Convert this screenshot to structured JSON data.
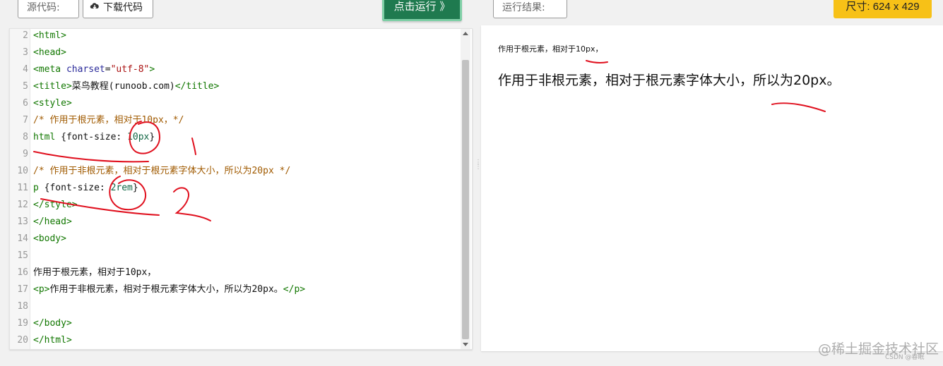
{
  "toolbar": {
    "source_label": "源代码:",
    "download_label": "下载代码",
    "run_label": "点击运行 》",
    "result_label": "运行结果:",
    "size_label": "尺寸: 624 x 429"
  },
  "editor": {
    "lines": [
      {
        "n": "2",
        "parts": [
          [
            "c-tag",
            "<html>"
          ]
        ]
      },
      {
        "n": "3",
        "parts": [
          [
            "c-tag",
            "<head>"
          ]
        ]
      },
      {
        "n": "4",
        "parts": [
          [
            "c-tag",
            "<meta "
          ],
          [
            "c-attr",
            "charset"
          ],
          [
            "c-text",
            "="
          ],
          [
            "c-str",
            "\"utf-8\""
          ],
          [
            "c-tag",
            ">"
          ]
        ]
      },
      {
        "n": "5",
        "parts": [
          [
            "c-tag",
            "<title>"
          ],
          [
            "c-text",
            "菜鸟教程(runoob.com)"
          ],
          [
            "c-tag",
            "</title>"
          ]
        ]
      },
      {
        "n": "6",
        "parts": [
          [
            "c-tag",
            "<style>"
          ]
        ]
      },
      {
        "n": "7",
        "parts": [
          [
            "c-comment",
            "/* 作用于根元素，相对于10px，*/"
          ]
        ]
      },
      {
        "n": "8",
        "parts": [
          [
            "c-sel",
            "html"
          ],
          [
            "c-text",
            " {font-size: "
          ],
          [
            "c-num",
            "10px"
          ],
          [
            "c-text",
            "}"
          ]
        ]
      },
      {
        "n": "9",
        "parts": []
      },
      {
        "n": "10",
        "parts": [
          [
            "c-comment",
            "/* 作用于非根元素，相对于根元素字体大小，所以为20px */"
          ]
        ]
      },
      {
        "n": "11",
        "parts": [
          [
            "c-sel",
            "p"
          ],
          [
            "c-text",
            " {font-size: "
          ],
          [
            "c-num",
            "2rem"
          ],
          [
            "c-text",
            "}"
          ]
        ]
      },
      {
        "n": "12",
        "parts": [
          [
            "c-tag",
            "</style>"
          ]
        ]
      },
      {
        "n": "13",
        "parts": [
          [
            "c-tag",
            "</head>"
          ]
        ]
      },
      {
        "n": "14",
        "parts": [
          [
            "c-tag",
            "<body>"
          ]
        ]
      },
      {
        "n": "15",
        "parts": []
      },
      {
        "n": "16",
        "parts": [
          [
            "c-text",
            "作用于根元素，相对于10px，"
          ]
        ]
      },
      {
        "n": "17",
        "parts": [
          [
            "c-tag",
            "<p>"
          ],
          [
            "c-text",
            "作用于非根元素，相对于根元素字体大小，所以为20px。"
          ],
          [
            "c-tag",
            "</p>"
          ]
        ]
      },
      {
        "n": "18",
        "parts": []
      },
      {
        "n": "19",
        "parts": [
          [
            "c-tag",
            "</body>"
          ]
        ]
      },
      {
        "n": "20",
        "parts": [
          [
            "c-tag",
            "</html>"
          ]
        ]
      }
    ]
  },
  "preview": {
    "small_text": "作用于根元素，相对于10px，",
    "large_text": "作用于非根元素，相对于根元素字体大小，所以为20px。"
  },
  "watermark": {
    "text": "@稀土掘金技术社区",
    "sub": "CSDN @春眠"
  },
  "colors": {
    "run_button": "#1f7a4f",
    "size_badge": "#f7c117",
    "annotation": "#e0101e"
  },
  "icons": {
    "download": "cloud-download-icon"
  }
}
